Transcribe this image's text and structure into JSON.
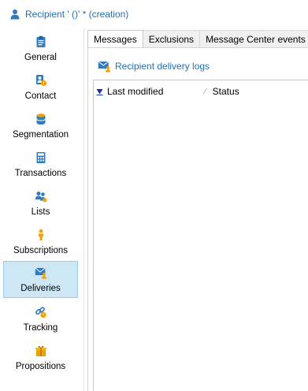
{
  "window": {
    "title": "Recipient '  ()' * (creation)"
  },
  "sidebar": {
    "items": [
      {
        "label": "General",
        "icon": "form-icon"
      },
      {
        "label": "Contact",
        "icon": "contact-card-icon"
      },
      {
        "label": "Segmentation",
        "icon": "database-icon"
      },
      {
        "label": "Transactions",
        "icon": "calculator-icon"
      },
      {
        "label": "Lists",
        "icon": "people-icon"
      },
      {
        "label": "Subscriptions",
        "icon": "subscriber-icon"
      },
      {
        "label": "Deliveries",
        "icon": "mail-person-icon"
      },
      {
        "label": "Tracking",
        "icon": "link-tracking-icon"
      },
      {
        "label": "Propositions",
        "icon": "gift-icon"
      }
    ],
    "active": "Deliveries"
  },
  "tabs": [
    {
      "label": "Messages"
    },
    {
      "label": "Exclusions"
    },
    {
      "label": "Message Center events"
    }
  ],
  "panel": {
    "link_label": "Recipient delivery logs",
    "columns": [
      "Last modified",
      "Status"
    ]
  },
  "colors": {
    "accent": "#1f6fb5",
    "active_bg": "#cde7f7",
    "icon_orange": "#f0a000"
  }
}
